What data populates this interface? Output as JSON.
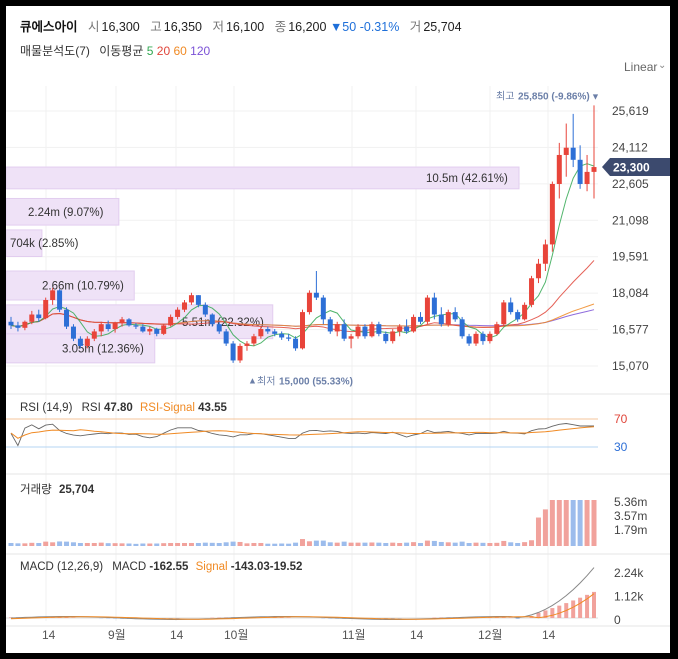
{
  "header": {
    "name": "큐에스아이",
    "open_label": "시",
    "open": "16,300",
    "high_label": "고",
    "high": "16,350",
    "low_label": "저",
    "low": "16,100",
    "close_label": "종",
    "close": "16,200",
    "change": "▼50",
    "change_pct": "-0.31%",
    "volume_label": "거",
    "volume": "25,704"
  },
  "indicators": {
    "volume_profile": "매물분석도(7)",
    "ma_label": "이동평균",
    "ma_periods": [
      "5",
      "20",
      "60",
      "120"
    ]
  },
  "scale_mode": "Linear",
  "colors": {
    "up": "#e8443a",
    "down": "#2d6fd6",
    "ma5": "#32a852",
    "ma20": "#e0453a",
    "ma60": "#f08a24",
    "ma120": "#7b52d6",
    "profile": "#efe2f7",
    "rsi": "#555555",
    "rsi_signal": "#f08a24"
  },
  "chart_data": {
    "type": "candlestick",
    "price_axis": {
      "ticks": [
        25619,
        24112,
        22605,
        21098,
        19591,
        18084,
        16577,
        15070
      ],
      "labels": [
        "25,619",
        "24,112",
        "22,605",
        "21,098",
        "19,591",
        "18,084",
        "16,577",
        "15,070"
      ]
    },
    "current_price": {
      "value": 23300,
      "label": "23,300"
    },
    "high_marker": {
      "label": "최고",
      "value": 25850,
      "text": "25,850 (-9.86%)"
    },
    "low_marker": {
      "label": "최저",
      "value": 15000,
      "text": "15,000 (55.33%)"
    },
    "x_labels": [
      "14",
      "9월",
      "14",
      "10월",
      "11월",
      "14",
      "12월",
      "14"
    ],
    "candles": [
      [
        16900,
        17100,
        16600,
        16750
      ],
      [
        16750,
        16900,
        16500,
        16650
      ],
      [
        16650,
        16950,
        16550,
        16900
      ],
      [
        16900,
        17350,
        16800,
        17200
      ],
      [
        17200,
        17400,
        16900,
        17050
      ],
      [
        17050,
        17900,
        17000,
        17800
      ],
      [
        17800,
        18300,
        17600,
        18200
      ],
      [
        18200,
        18250,
        17300,
        17400
      ],
      [
        17400,
        17500,
        16600,
        16700
      ],
      [
        16700,
        16800,
        16100,
        16200
      ],
      [
        16200,
        16300,
        15800,
        15900
      ],
      [
        15900,
        16300,
        15800,
        16200
      ],
      [
        16200,
        16600,
        16100,
        16500
      ],
      [
        16500,
        16900,
        16300,
        16800
      ],
      [
        16800,
        16950,
        16500,
        16600
      ],
      [
        16600,
        16900,
        16450,
        16850
      ],
      [
        16850,
        17100,
        16700,
        17000
      ],
      [
        17000,
        17050,
        16700,
        16750
      ],
      [
        16750,
        16850,
        16600,
        16700
      ],
      [
        16700,
        16800,
        16450,
        16500
      ],
      [
        16500,
        16700,
        16350,
        16600
      ],
      [
        16600,
        16650,
        16300,
        16400
      ],
      [
        16400,
        16800,
        16350,
        16750
      ],
      [
        16750,
        17200,
        16700,
        17100
      ],
      [
        17100,
        17500,
        17000,
        17400
      ],
      [
        17400,
        17800,
        17300,
        17700
      ],
      [
        17700,
        18100,
        17600,
        18000
      ],
      [
        18000,
        18000,
        17500,
        17600
      ],
      [
        17600,
        17700,
        17100,
        17200
      ],
      [
        17200,
        17250,
        16700,
        16800
      ],
      [
        16800,
        16900,
        16400,
        16500
      ],
      [
        16500,
        16600,
        15900,
        16000
      ],
      [
        16000,
        16100,
        15200,
        15300
      ],
      [
        15300,
        16000,
        15200,
        15900
      ],
      [
        15900,
        16100,
        15700,
        16000
      ],
      [
        16000,
        16400,
        15900,
        16300
      ],
      [
        16300,
        16700,
        16200,
        16600
      ],
      [
        16600,
        16700,
        16400,
        16500
      ],
      [
        16500,
        16600,
        16300,
        16400
      ],
      [
        16400,
        16500,
        16150,
        16250
      ],
      [
        16250,
        16400,
        16100,
        16200
      ],
      [
        16200,
        16300,
        15700,
        15800
      ],
      [
        15800,
        17400,
        15750,
        17300
      ],
      [
        17300,
        18200,
        17200,
        18100
      ],
      [
        18100,
        19000,
        17800,
        17900
      ],
      [
        17900,
        18000,
        16800,
        17000
      ],
      [
        17000,
        17100,
        16400,
        16500
      ],
      [
        16500,
        16900,
        16300,
        16800
      ],
      [
        16800,
        17000,
        16100,
        16200
      ],
      [
        16200,
        16400,
        15800,
        16300
      ],
      [
        16300,
        16800,
        16200,
        16700
      ],
      [
        16700,
        16800,
        16200,
        16300
      ],
      [
        16300,
        16900,
        16250,
        16800
      ],
      [
        16800,
        16900,
        16300,
        16400
      ],
      [
        16400,
        16500,
        16000,
        16100
      ],
      [
        16100,
        16600,
        16000,
        16500
      ],
      [
        16500,
        16800,
        16300,
        16700
      ],
      [
        16700,
        17000,
        16400,
        16500
      ],
      [
        16500,
        17200,
        16450,
        17100
      ],
      [
        17100,
        17300,
        16800,
        16900
      ],
      [
        16900,
        18000,
        16800,
        17900
      ],
      [
        17900,
        18100,
        17000,
        17200
      ],
      [
        17200,
        17500,
        16700,
        16800
      ],
      [
        16800,
        17400,
        16700,
        17300
      ],
      [
        17300,
        17500,
        16900,
        17000
      ],
      [
        17000,
        17100,
        16200,
        16300
      ],
      [
        16300,
        16400,
        15900,
        16000
      ],
      [
        16000,
        16500,
        15900,
        16400
      ],
      [
        16400,
        16500,
        15950,
        16100
      ],
      [
        16100,
        16500,
        16000,
        16400
      ],
      [
        16400,
        16900,
        16350,
        16800
      ],
      [
        16800,
        17800,
        16700,
        17700
      ],
      [
        17700,
        17900,
        17200,
        17300
      ],
      [
        17300,
        17400,
        16900,
        17000
      ],
      [
        17000,
        17700,
        16950,
        17600
      ],
      [
        17600,
        18800,
        17500,
        18700
      ],
      [
        18700,
        19500,
        18500,
        19300
      ],
      [
        19300,
        20300,
        19000,
        20100
      ],
      [
        20100,
        22700,
        19800,
        22600
      ],
      [
        22600,
        24300,
        22000,
        23800
      ],
      [
        23800,
        25100,
        22900,
        24100
      ],
      [
        24100,
        25500,
        23300,
        23600
      ],
      [
        23600,
        24200,
        22400,
        22600
      ],
      [
        22600,
        23800,
        22300,
        23100
      ],
      [
        23100,
        25850,
        22000,
        23300
      ]
    ],
    "profile": [
      {
        "range": [
          22400,
          23300
        ],
        "volume_text": "10.5m",
        "pct_text": "(42.61%)",
        "width_frac": 1.0
      },
      {
        "range": [
          20900,
          22000
        ],
        "volume_text": "2.24m",
        "pct_text": "(9.07%)",
        "width_frac": 0.22
      },
      {
        "range": [
          19600,
          20700
        ],
        "volume_text": "704k",
        "pct_text": "(2.85%)",
        "width_frac": 0.07
      },
      {
        "range": [
          17800,
          19000
        ],
        "volume_text": "2.66m",
        "pct_text": "(10.79%)",
        "width_frac": 0.25
      },
      {
        "range": [
          16200,
          17600
        ],
        "volume_text": "5.51m",
        "pct_text": "(22.32%)",
        "width_frac": 0.52
      },
      {
        "range": [
          15200,
          16400
        ],
        "volume_text": "3.05m",
        "pct_text": "(12.36%)",
        "width_frac": 0.29
      }
    ],
    "rsi": {
      "label": "RSI (14,9)",
      "rsi_label": "RSI",
      "rsi_value": "47.80",
      "signal_label": "RSI-Signal",
      "signal_value": "43.55",
      "levels": [
        "70",
        "30"
      ]
    },
    "volume_panel": {
      "label": "거래량",
      "value": "25,704",
      "ticks": [
        "5.36m",
        "3.57m",
        "1.79m"
      ]
    },
    "macd": {
      "label": "MACD (12,26,9)",
      "macd_label": "MACD",
      "macd_value": "-162.55",
      "signal_label": "Signal",
      "signal_value": "-143.03",
      "hist_value": "-19.52",
      "ticks": [
        "2.24k",
        "1.12k",
        "0"
      ]
    }
  }
}
